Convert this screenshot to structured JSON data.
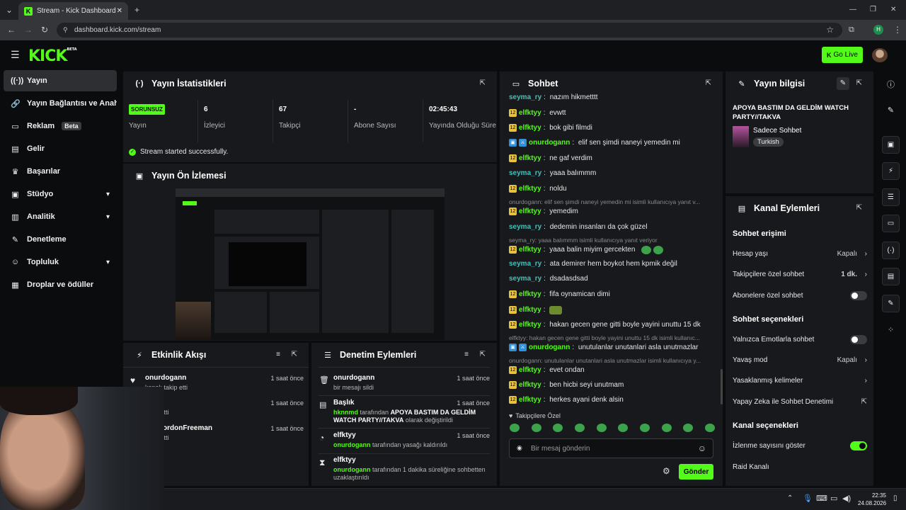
{
  "browser": {
    "tab_title": "Stream - Kick Dashboard",
    "url": "dashboard.kick.com/stream",
    "profile_initial": "H"
  },
  "header": {
    "logo": "KICK",
    "logo_sup": "BETA",
    "go_live": "Go Live"
  },
  "colors": {
    "accent": "#53fc18",
    "bg": "#0b0c0d",
    "panel": "#18191c"
  },
  "sidebar": {
    "items": [
      {
        "label": "Yayın",
        "icon": "broadcast-icon"
      },
      {
        "label": "Yayın Bağlantısı ve Anahtarı",
        "icon": "link-icon"
      },
      {
        "label": "Reklam",
        "badge": "Beta",
        "icon": "ad-icon"
      },
      {
        "label": "Gelir",
        "icon": "revenue-icon"
      },
      {
        "label": "Başarılar",
        "icon": "trophy-icon"
      },
      {
        "label": "Stüdyo",
        "icon": "studio-icon"
      },
      {
        "label": "Analitik",
        "icon": "analytics-icon"
      },
      {
        "label": "Denetleme",
        "icon": "wrench-icon"
      },
      {
        "label": "Topluluk",
        "icon": "community-icon"
      },
      {
        "label": "Droplar ve ödüller",
        "icon": "drops-icon"
      }
    ]
  },
  "stats": {
    "title": "Yayın İstatistikleri",
    "status_badge": "SORUNSUZ",
    "cells": [
      {
        "value": "",
        "label": "Yayın"
      },
      {
        "value": "6",
        "label": "İzleyici"
      },
      {
        "value": "67",
        "label": "Takipçi"
      },
      {
        "value": "-",
        "label": "Abone Sayısı"
      },
      {
        "value": "02:45:43",
        "label": "Yayında Olduğu Süre"
      }
    ],
    "success_msg": "Stream started successfully."
  },
  "preview": {
    "title": "Yayın Ön İzlemesi"
  },
  "activity": {
    "title": "Etkinlik Akışı",
    "items": [
      {
        "name": "onurdogann",
        "sub": "kanalı takip etti",
        "time": "1 saat önce"
      },
      {
        "name": "ka",
        "sub": "takip etti",
        "time": "1 saat önce"
      },
      {
        "name": "kenGordonFreeman",
        "sub": "takip etti",
        "time": "1 saat önce"
      }
    ]
  },
  "moderation": {
    "title": "Denetim Eylemleri",
    "items": [
      {
        "name": "onurdogann",
        "sub": "bir mesajı sildi",
        "time": "1 saat önce"
      },
      {
        "name": "Başlık",
        "actor": "hknnmd",
        "sub1": "tarafından",
        "bold": "APOYA BASTIM DA GELDİM WATCH PARTY//TAKVA",
        "sub2": "olarak değiştirildi",
        "time": "1 saat önce"
      },
      {
        "name": "elfktyy",
        "actor": "onurdogann",
        "sub": "tarafından yasağı kaldırıldı",
        "time": "1 saat önce"
      },
      {
        "name": "elfktyy",
        "actor": "onurdogann",
        "sub": "tarafından 1 dakika süreliğine sohbetten uzaklaştırıldı",
        "time": "1 saat önce"
      }
    ]
  },
  "chat": {
    "title": "Sohbet",
    "messages": [
      {
        "user": "seyma_ry",
        "text": "nazım hikmetttt"
      },
      {
        "user": "elfktyy",
        "text": "evwtt"
      },
      {
        "user": "elfktyy",
        "text": "bok gibi filmdi"
      },
      {
        "user": "onurdogann",
        "text": "elif sen şimdi naneyi yemedin mi"
      },
      {
        "user": "elfktyy",
        "text": "ne gaf verdim"
      },
      {
        "user": "seyma_ry",
        "text": "yaaa balımmm"
      },
      {
        "user": "elfktyy",
        "text": "noldu"
      },
      {
        "reply": "onurdogann: elif sen şimdi naneyi yemedin mi isimli kullanıcıya yanıt v..."
      },
      {
        "user": "elfktyy",
        "text": "yemedim"
      },
      {
        "user": "seyma_ry",
        "text": "dedemin insanları da çok güzel"
      },
      {
        "reply": "seyma_ry: yaaa balımmm isimli kullanıcıya yanıt veriyor"
      },
      {
        "user": "elfktyy",
        "text": "yaaa balin miyim gercekten"
      },
      {
        "user": "seyma_ry",
        "text": "ata demirer hem boykot hem kpmik değil"
      },
      {
        "user": "seyma_ry",
        "text": "dsadasdsad"
      },
      {
        "user": "elfktyy",
        "text": "fifa oynamican dimi"
      },
      {
        "user": "elfktyy",
        "text": ""
      },
      {
        "user": "elfktyy",
        "text": "hakan gecen gene gitti boyle yayini unuttu 15 dk"
      },
      {
        "reply": "elfktyy: hakan gecen gene gitti boyle yayini unuttu 15 dk isimli kullanıc..."
      },
      {
        "user": "onurdogann",
        "text": "unutulanlar unutanlari asla unutmazlar"
      },
      {
        "reply": "onurdogann: unutulanlar unutanlari asla unutmazlar isimli kullanıcıya y..."
      },
      {
        "user": "elfktyy",
        "text": "evet ondan"
      },
      {
        "user": "elfktyy",
        "text": "ben hicbi seyi unutmam"
      },
      {
        "user": "elfktyy",
        "text": "herkes ayani denk alsin"
      }
    ],
    "followers_only": "Takipçilere Özel",
    "input_placeholder": "Bir mesaj gönderin",
    "send": "Gönder"
  },
  "stream_info": {
    "title": "Yayın bilgisi",
    "stream_title": "APOYA BASTIM DA GELDİM WATCH PARTY//TAKVA",
    "category": "Sadece Sohbet",
    "tag": "Turkish"
  },
  "channel_actions": {
    "title": "Kanal Eylemleri",
    "sec1": "Sohbet erişimi",
    "account_age": "Hesap yaşı",
    "account_age_val": "Kapalı",
    "followers_chat": "Takipçilere özel sohbet",
    "followers_chat_val": "1 dk.",
    "subs_chat": "Abonelere özel sohbet",
    "sec2": "Sohbet seçenekleri",
    "emote_only": "Yalnızca Emotlarla sohbet",
    "slow_mode": "Yavaş mod",
    "slow_mode_val": "Kapalı",
    "banned_words": "Yasaklanmış kelimeler",
    "ai_mod": "Yapay Zeka ile Sohbet Denetimi",
    "sec3": "Kanal seçenekleri",
    "show_viewers": "İzlenme sayısını göster",
    "raid": "Raid Kanalı"
  },
  "taskbar": {
    "time": "22:35",
    "date": "24.08.2026"
  }
}
